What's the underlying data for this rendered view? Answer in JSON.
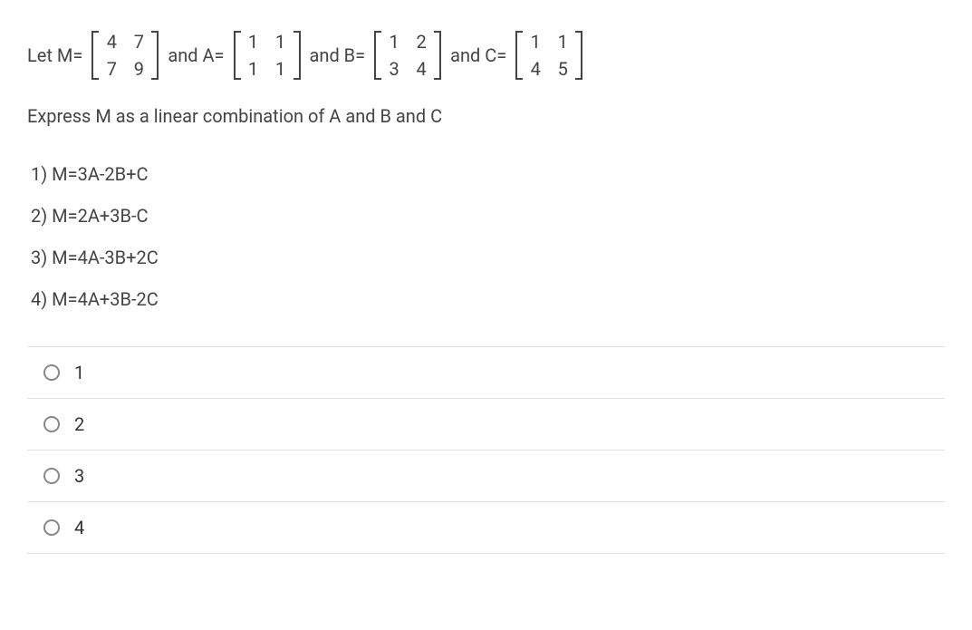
{
  "question": {
    "prefix_let": "Let M=",
    "and_a": " and A=",
    "and_b": " and B=",
    "and_c": " and C=",
    "matrices": {
      "M": [
        [
          "4",
          "7"
        ],
        [
          "7",
          "9"
        ]
      ],
      "A": [
        [
          "1",
          "1"
        ],
        [
          "1",
          "1"
        ]
      ],
      "B": [
        [
          "1",
          "2"
        ],
        [
          "3",
          "4"
        ]
      ],
      "C": [
        [
          "1",
          "1"
        ],
        [
          "4",
          "5"
        ]
      ]
    },
    "instruction": "Express M as a linear combination of A and B and C"
  },
  "options": [
    {
      "label": "1) M=3A-2B+C"
    },
    {
      "label": "2) M=2A+3B-C"
    },
    {
      "label": "3) M=4A-3B+2C"
    },
    {
      "label": "4) M=4A+3B-2C"
    }
  ],
  "answers": [
    {
      "label": "1"
    },
    {
      "label": "2"
    },
    {
      "label": "3"
    },
    {
      "label": "4"
    }
  ]
}
